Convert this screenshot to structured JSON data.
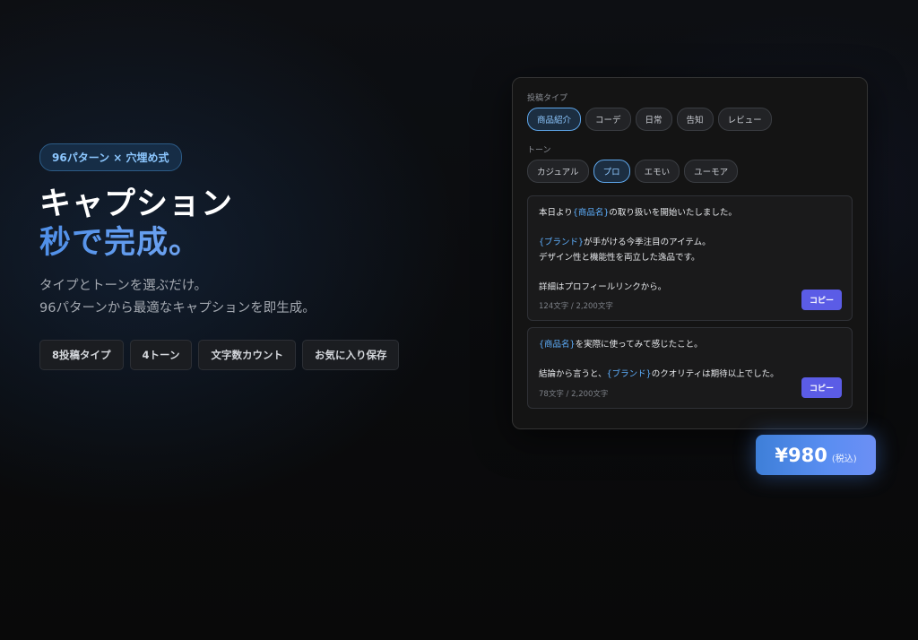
{
  "hero": {
    "badge": "96パターン × 穴埋め式",
    "title_line1": "キャプション",
    "title_line2": "秒で完成。",
    "desc_line1": "タイプとトーンを選ぶだけ。",
    "desc_line2": "96パターンから最適なキャプションを即生成。",
    "features": [
      "8投稿タイプ",
      "4トーン",
      "文字数カウント",
      "お気に入り保存"
    ]
  },
  "panel": {
    "post_type_label": "投稿タイプ",
    "post_types": [
      "商品紹介",
      "コーデ",
      "日常",
      "告知",
      "レビュー"
    ],
    "post_type_selected": "商品紹介",
    "tone_label": "トーン",
    "tones": [
      "カジュアル",
      "プロ",
      "エモい",
      "ユーモア"
    ],
    "tone_selected": "プロ",
    "card1": {
      "l1_a": "本日より",
      "l1_ph": "{商品名}",
      "l1_b": "の取り扱いを開始いたしました。",
      "l2_ph": "{ブランド}",
      "l2_b": "が手がける今季注目のアイテム。",
      "l3": "デザイン性と機能性を両立した逸品です。",
      "l4": "詳細はプロフィールリンクから。",
      "count": "124文字 / 2,200文字",
      "copy_label": "コピー"
    },
    "card2": {
      "l1_ph": "{商品名}",
      "l1_b": "を実際に使ってみて感じたこと。",
      "l2_a": "結論から言うと、",
      "l2_ph": "{ブランド}",
      "l2_b": "のクオリティは期待以上でした。",
      "count": "78文字 / 2,200文字",
      "copy_label": "コピー"
    }
  },
  "price": {
    "amount": "¥980",
    "tax": "(税込)"
  },
  "colors": {
    "accent_blue": "#5eb0ff",
    "copy_button": "#5b5ce6",
    "price_gradient_start": "#3e7fd8",
    "price_gradient_end": "#6c8ff5"
  }
}
